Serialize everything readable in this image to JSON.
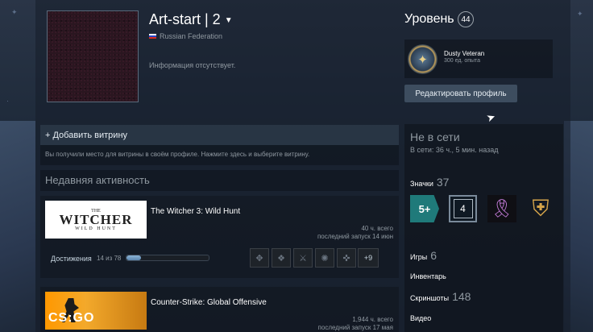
{
  "profile": {
    "username": "Art-start | 2",
    "country": "Russian Federation",
    "summary": "Информация отсутствует."
  },
  "level": {
    "label": "Уровень",
    "value": "44",
    "badge_name": "Dusty Veteran",
    "badge_xp": "300 ед. опыта",
    "edit_button": "Редактировать профиль"
  },
  "showcase": {
    "title": "+ Добавить витрину",
    "description": "Вы получили место для витрины в своём профиле. Нажмите здесь и выберите витрину."
  },
  "recent": {
    "title": "Недавняя активность",
    "games": [
      {
        "name": "The Witcher 3: Wild Hunt",
        "hours": "40 ч. всего",
        "last_played": "последний запуск 14 июн",
        "achievements_label": "Достижения",
        "achievements_count": "14 из 78",
        "achievements_progress": 0.18,
        "more_achievements": "+9",
        "art_text": {
          "top": "THE",
          "main": "WITCHER",
          "sub": "WILD HUNT"
        }
      },
      {
        "name": "Counter-Strike: Global Offensive",
        "hours": "1,944 ч. всего",
        "last_played": "последний запуск 17 мая",
        "art_text": {
          "main": "CS:GO"
        }
      }
    ]
  },
  "sidebar": {
    "status": "Не в сети",
    "last_seen": "В сети: 36 ч., 5 мин. назад",
    "badges_label": "Значки",
    "badges_count": "37",
    "badge_items": [
      "5+",
      "4"
    ],
    "games_label": "Игры",
    "games_count": "6",
    "inventory_label": "Инвентарь",
    "screenshots_label": "Скриншоты",
    "screenshots_count": "148",
    "videos_label": "Видео"
  }
}
